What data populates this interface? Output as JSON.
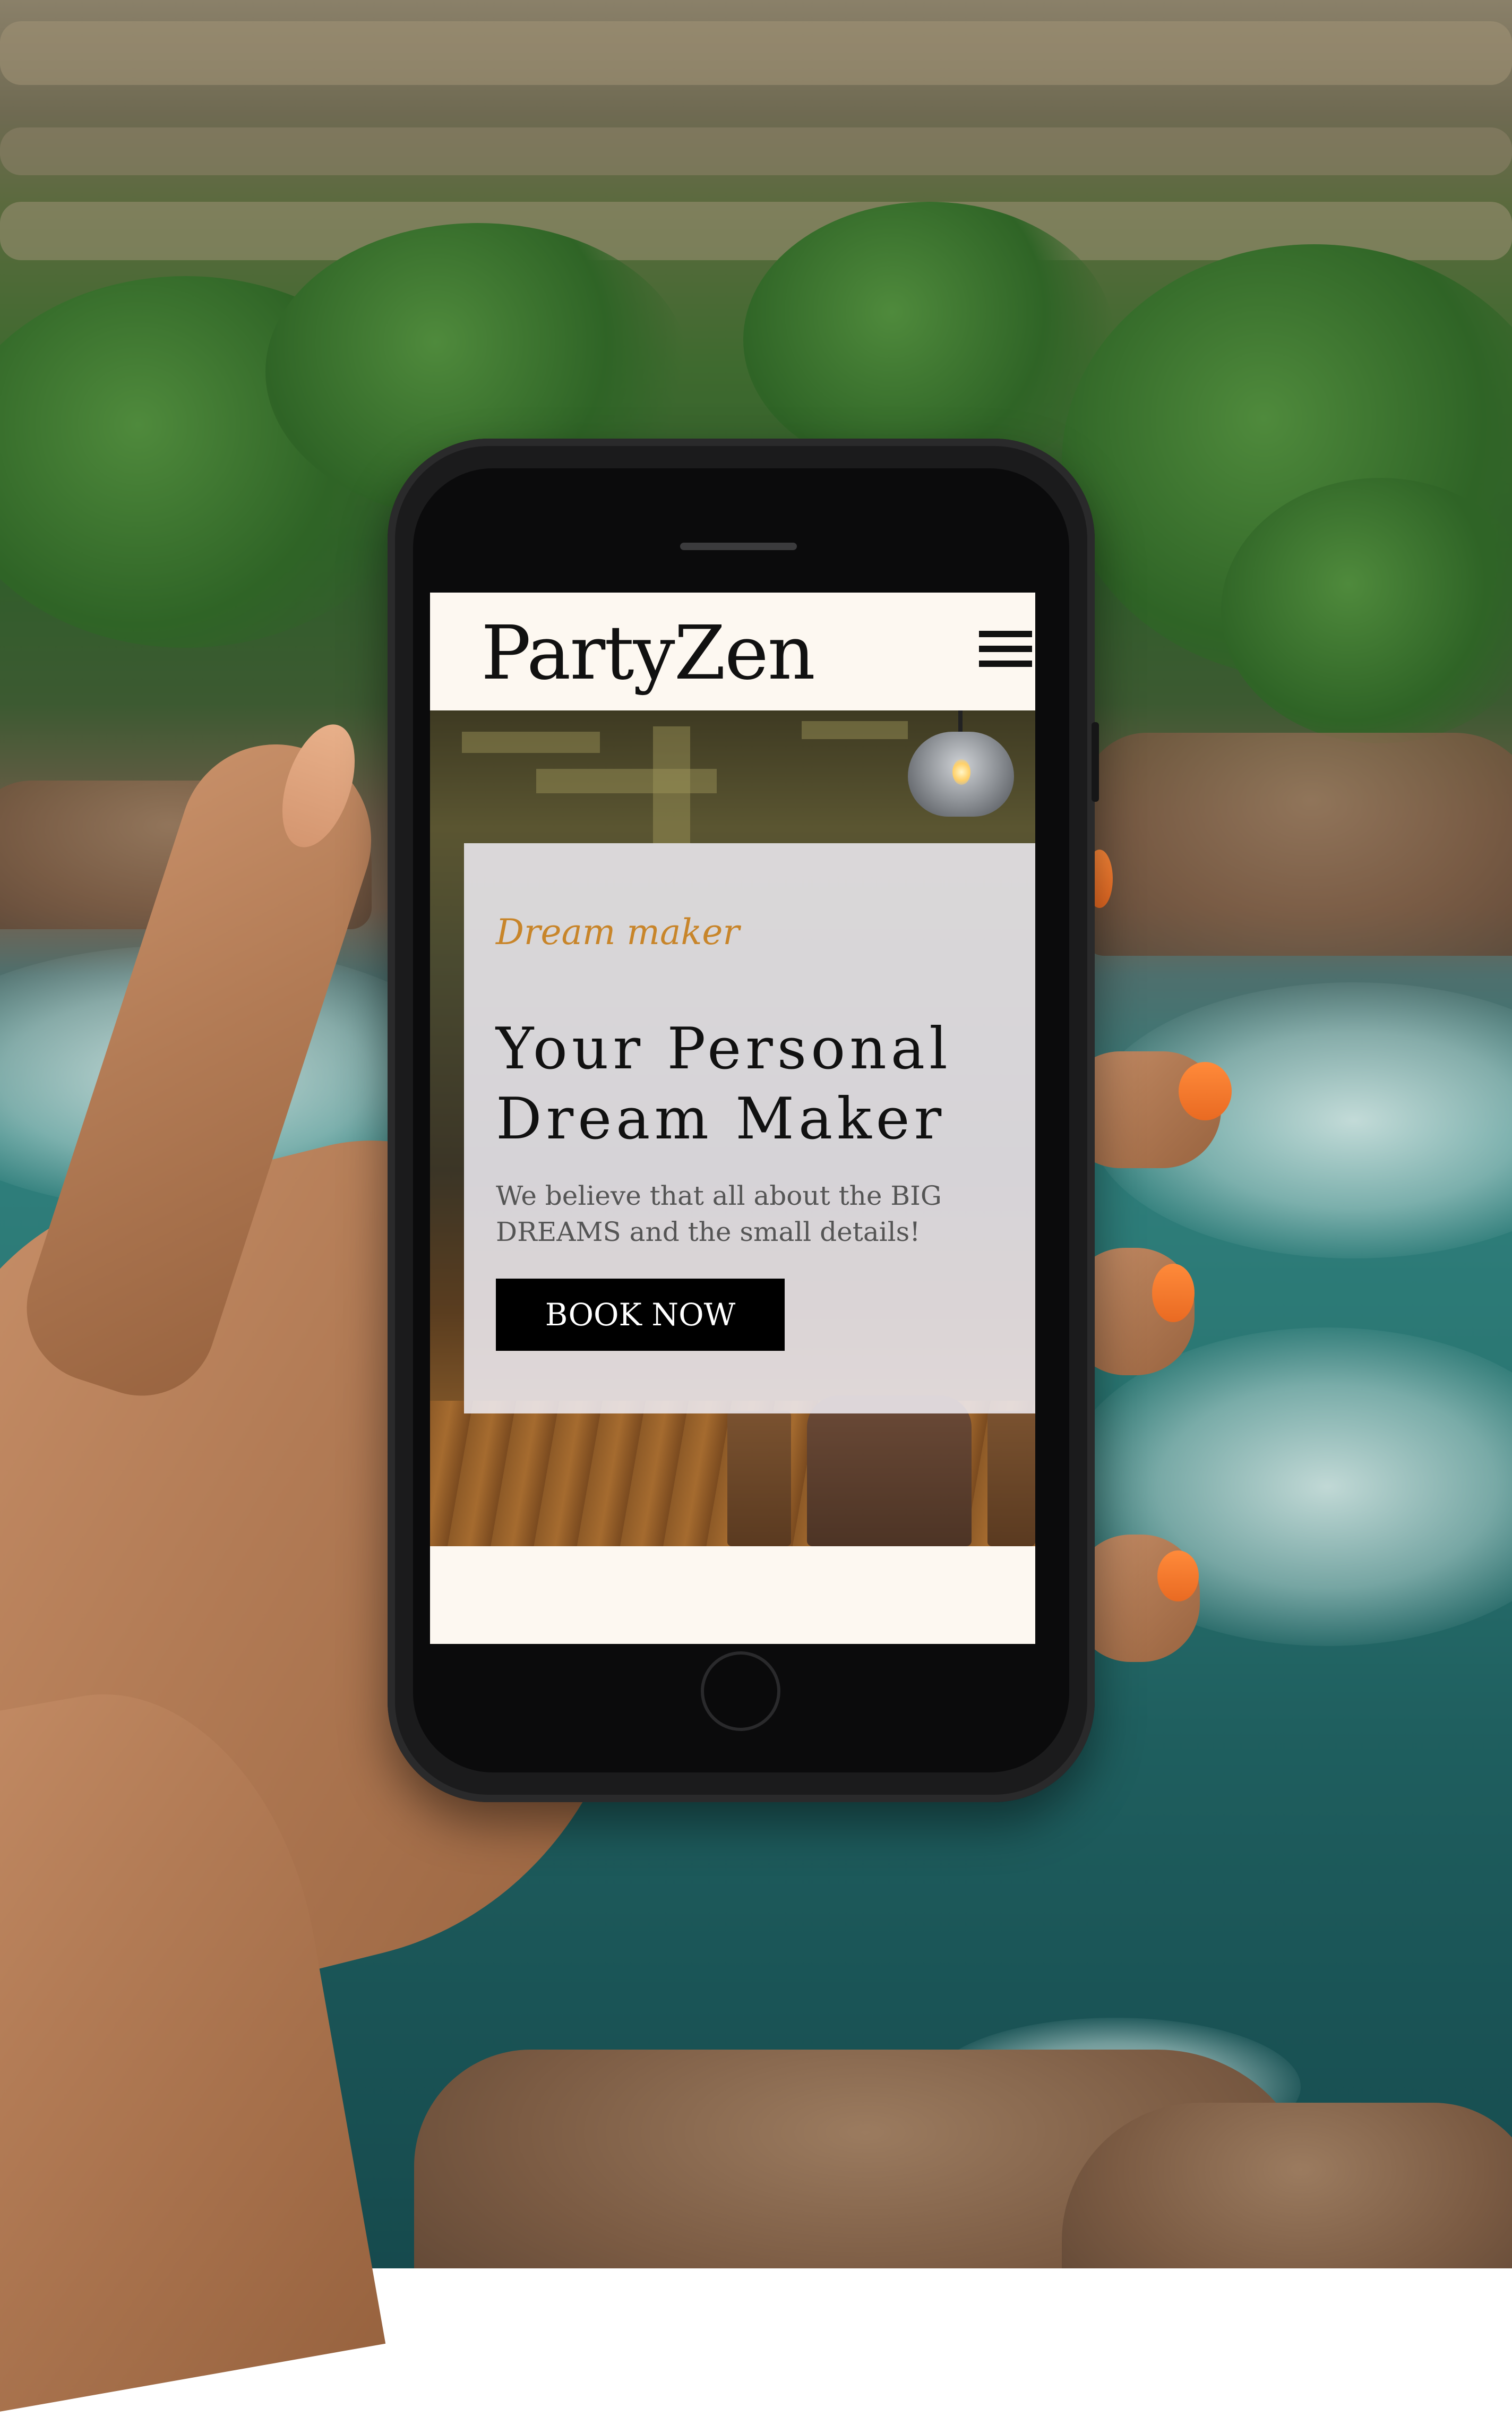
{
  "site": {
    "brand": "PartyZen",
    "menu_icon": "hamburger-menu-icon"
  },
  "hero": {
    "tagline": "Dream maker",
    "title_line1": "Your Personal",
    "title_line2": "Dream Maker",
    "subtitle_line1": "We believe that all about the BIG",
    "subtitle_line2": "DREAMS and the small details!",
    "cta_label": "BOOK NOW"
  },
  "colors": {
    "page_background": "#fdf8f1",
    "brand_text": "#111111",
    "tagline_accent": "#c8852a",
    "button_background": "#000000",
    "button_text": "#ffffff",
    "card_overlay": "#f0eef4",
    "subtitle_text": "#555555"
  }
}
